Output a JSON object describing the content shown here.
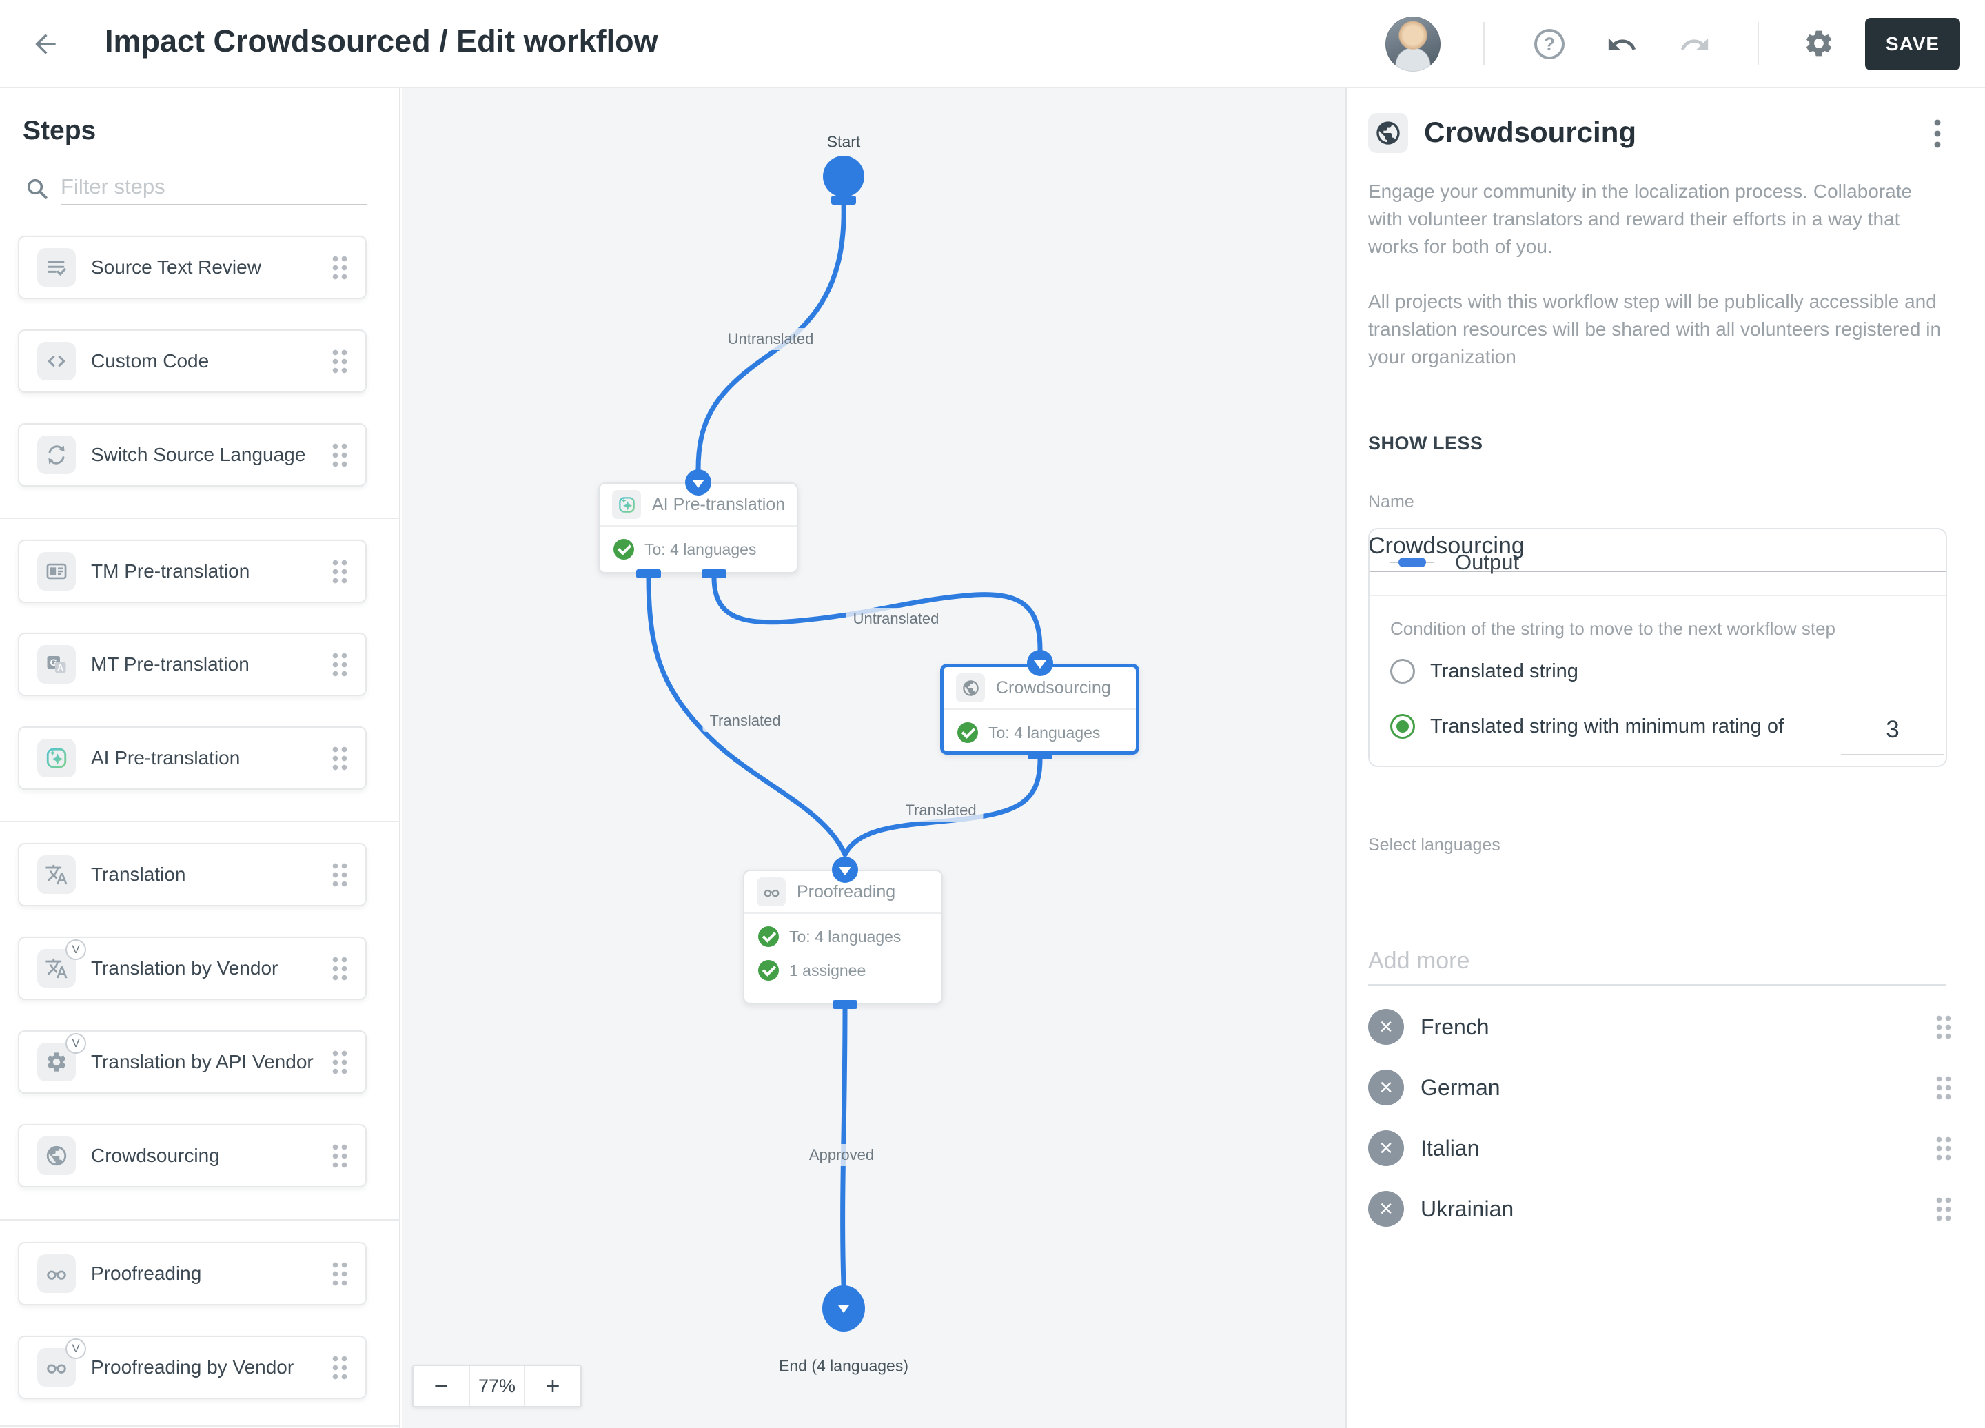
{
  "topbar": {
    "title": "Impact Crowdsourced / Edit workflow",
    "save_label": "SAVE",
    "icons": [
      "back-arrow",
      "avatar",
      "help-circle",
      "undo",
      "redo",
      "gear"
    ]
  },
  "sidebar": {
    "title": "Steps",
    "filter_placeholder": "Filter steps",
    "items": [
      {
        "label": "Source Text Review",
        "icon": "source-text-review"
      },
      {
        "label": "Custom Code",
        "icon": "code-brackets"
      },
      {
        "label": "Switch Source Language",
        "icon": "switch-arrows"
      },
      {
        "label": "TM Pre-translation",
        "icon": "tm-card"
      },
      {
        "label": "MT Pre-translation",
        "icon": "machine-translate"
      },
      {
        "label": "AI Pre-translation",
        "icon": "ai-sparkle"
      },
      {
        "label": "Translation",
        "icon": "translate"
      },
      {
        "label": "Translation by Vendor",
        "icon": "translate",
        "badge": "V"
      },
      {
        "label": "Translation by API Vendor",
        "icon": "gear",
        "badge": "V"
      },
      {
        "label": "Crowdsourcing",
        "icon": "globe"
      },
      {
        "label": "Proofreading",
        "icon": "glasses"
      },
      {
        "label": "Proofreading by Vendor",
        "icon": "glasses",
        "badge": "V"
      }
    ]
  },
  "canvas": {
    "start_label": "Start",
    "end_label": "End (4 languages)",
    "edge_labels": {
      "start_to_ai": "Untranslated",
      "ai_to_crowdsourcing": "Untranslated",
      "ai_to_proofreading": "Translated",
      "crowdsourcing_to_proofreading": "Translated",
      "proofreading_to_end": "Approved"
    },
    "nodes": {
      "ai": {
        "title": "AI Pre-translation",
        "row1": "To: 4 languages"
      },
      "crowdsourcing": {
        "title": "Crowdsourcing",
        "row1": "To: 4 languages",
        "selected": true
      },
      "proofreading": {
        "title": "Proofreading",
        "row1": "To: 4 languages",
        "row2": "1 assignee"
      }
    },
    "zoom": {
      "out": "−",
      "value": "77%",
      "in": "+"
    }
  },
  "inspector": {
    "title": "Crowdsourcing",
    "description_1": "Engage your community in the localization process. Collaborate with volunteer translators and reward their efforts in a way that works for both of you.",
    "description_2": "All projects with this workflow step will be publically accessible and translation resources will be shared with all volunteers registered in your organization",
    "show_less": "SHOW LESS",
    "name_label": "Name",
    "name_value": "Crowdsourcing",
    "output": {
      "title": "Output",
      "condition_label": "Condition of the string to move to the next workflow step",
      "options": [
        {
          "label": "Translated string",
          "selected": false
        },
        {
          "label": "Translated string with minimum rating of",
          "selected": true,
          "value": "3"
        }
      ]
    },
    "select_languages_label": "Select languages",
    "add_more_placeholder": "Add more",
    "languages": [
      "French",
      "German",
      "Italian",
      "Ukrainian"
    ]
  },
  "colors": {
    "accent_blue": "#2E7CE0",
    "success_green": "#43A047",
    "save_button_bg": "#263238",
    "canvas_bg": "#F4F5F7"
  }
}
